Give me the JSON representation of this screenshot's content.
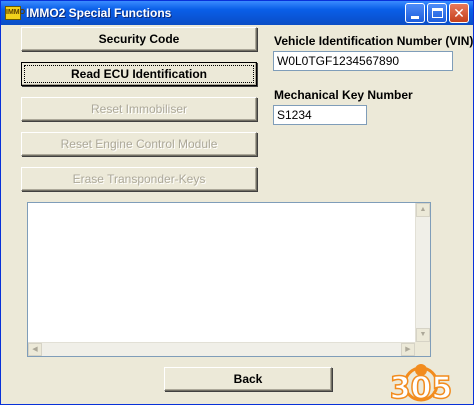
{
  "window": {
    "title": "IMMO2 Special Functions",
    "app_icon_text": "IMMO"
  },
  "buttons": {
    "security_code": "Security Code",
    "read_ecu": "Read ECU Identification",
    "reset_immobiliser": "Reset Immobiliser",
    "reset_ecm": "Reset Engine Control Module",
    "erase_keys": "Erase Transponder-Keys",
    "back": "Back"
  },
  "fields": {
    "vin_label": "Vehicle Identification Number (VIN)",
    "vin_value": "W0L0TGF1234567890",
    "key_label": "Mechanical Key Number",
    "key_value": "S1234"
  },
  "logo": {
    "text": "305"
  },
  "colors": {
    "title_bar": "#0a55d6",
    "window_bg": "#ece9d8",
    "logo_orange": "#f28c1e"
  }
}
